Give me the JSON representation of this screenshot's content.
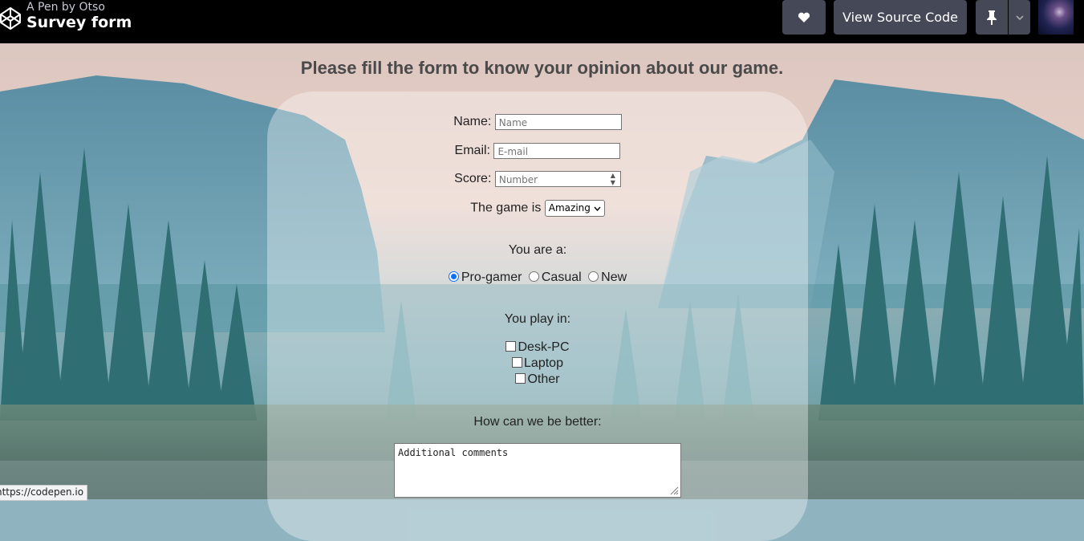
{
  "header": {
    "pen_by": "A Pen by Otso",
    "title": "Survey form",
    "view_source_label": "View Source Code",
    "icons": [
      "codepen-logo-icon",
      "heart-icon",
      "pin-icon",
      "chevron-down-icon"
    ]
  },
  "form": {
    "heading": "Please fill the form to know your opinion about our game.",
    "name_label": "Name:",
    "name_placeholder": "Name",
    "email_label": "Email:",
    "email_placeholder": "E-mail",
    "score_label": "Score:",
    "score_placeholder": "Number",
    "game_label": "The game is",
    "game_selected": "Amazing",
    "you_are_label": "You are a:",
    "roles": [
      {
        "label": "Pro-gamer",
        "checked": true
      },
      {
        "label": "Casual",
        "checked": false
      },
      {
        "label": "New",
        "checked": false
      }
    ],
    "play_in_label": "You play in:",
    "platforms": [
      {
        "label": "Desk-PC",
        "checked": false
      },
      {
        "label": "Laptop",
        "checked": false
      },
      {
        "label": "Other",
        "checked": false
      }
    ],
    "better_label": "How can we be better:",
    "comments_placeholder": "Additional comments"
  },
  "status_bar": {
    "url": "https://codepen.io"
  },
  "colors": {
    "topbar": "#000000",
    "button": "#444857",
    "radio_accent": "#0d6efd"
  }
}
